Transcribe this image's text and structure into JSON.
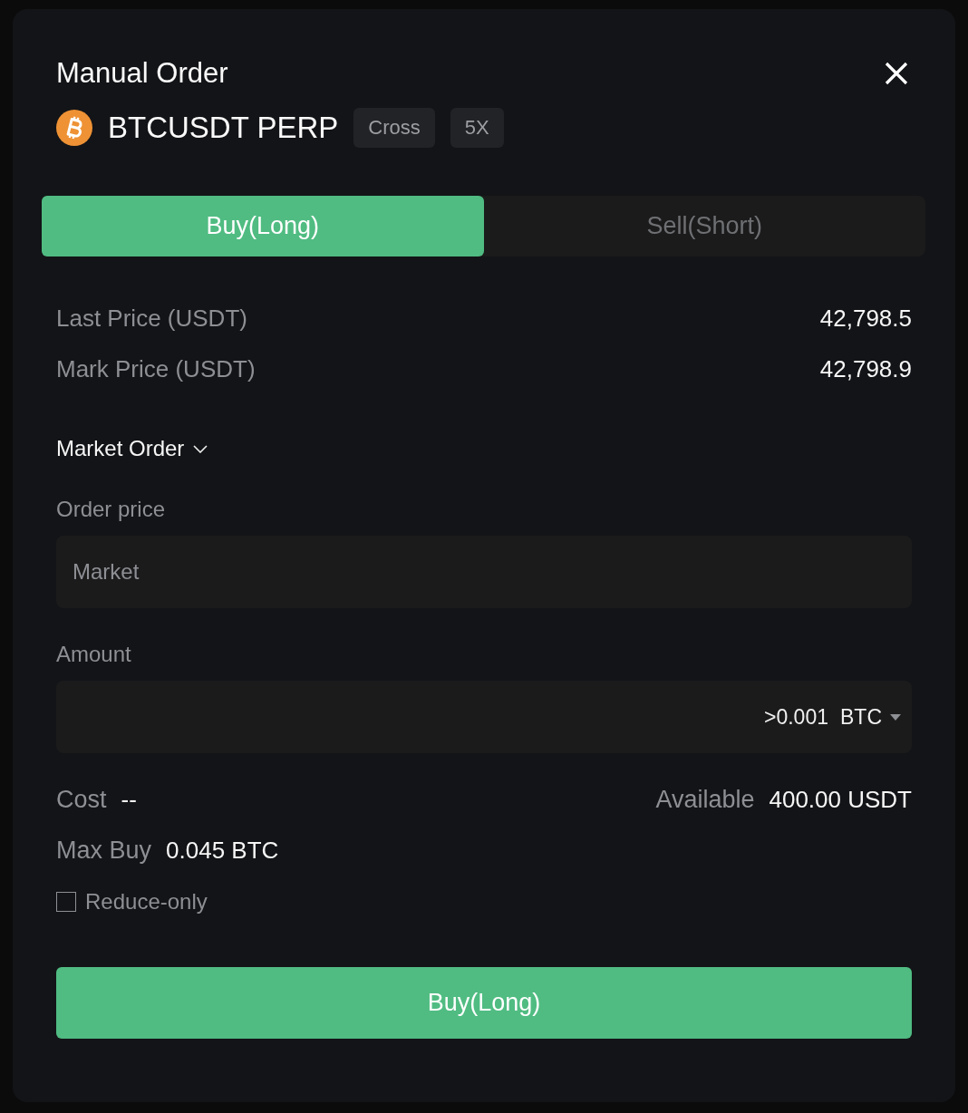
{
  "dialog": {
    "title": "Manual Order"
  },
  "instrument": {
    "symbol": "BTCUSDT PERP",
    "badges": [
      "Cross",
      "5X"
    ]
  },
  "side_tabs": [
    {
      "label": "Buy(Long)",
      "selected": true
    },
    {
      "label": "Sell(Short)",
      "selected": false
    }
  ],
  "prices": [
    {
      "label": "Last Price (USDT)",
      "value": "42,798.5"
    },
    {
      "label": "Mark Price (USDT)",
      "value": "42,798.9"
    }
  ],
  "order_type": {
    "label": "Market Order"
  },
  "fields": [
    {
      "kind": "price",
      "label": "Order price",
      "placeholder": "Market"
    },
    {
      "kind": "amount",
      "label": "Amount",
      "placeholder": ">0.001",
      "unit": "BTC"
    }
  ],
  "summary_rows": [
    [
      {
        "label": "Cost",
        "value": "--"
      },
      {
        "label": "Available",
        "value": "400.00 USDT"
      }
    ],
    [
      {
        "label": "Max Buy",
        "value": "0.045 BTC"
      }
    ]
  ],
  "reduce_only": {
    "label": "Reduce-only",
    "checked": false
  },
  "submit": {
    "label": "Buy(Long)"
  }
}
